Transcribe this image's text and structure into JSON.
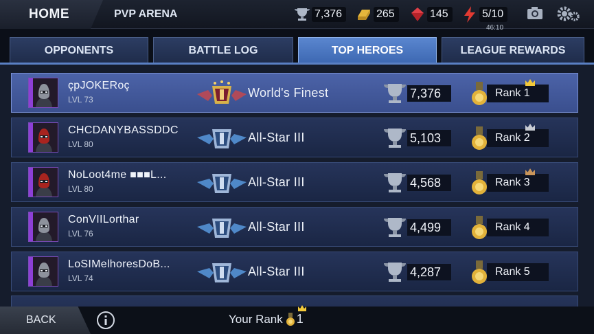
{
  "header": {
    "home_label": "HOME",
    "page_title": "PVP ARENA",
    "trophies": "7,376",
    "gold": "265",
    "crystals": "145",
    "energy": "5/10",
    "energy_timer": "46:10"
  },
  "tabs": [
    {
      "label": "OPPONENTS",
      "active": false
    },
    {
      "label": "BATTLE LOG",
      "active": false
    },
    {
      "label": "TOP HEROES",
      "active": true
    },
    {
      "label": "LEAGUE REWARDS",
      "active": false
    }
  ],
  "rows": [
    {
      "name": "çpJOKERoç",
      "level": "LVL 73",
      "league": "World's Finest",
      "score": "7,376",
      "rank": "Rank 1",
      "highlight": true,
      "crown_color": "#f3c93a"
    },
    {
      "name": "CHCDANYBASSDDC",
      "level": "LVL 80",
      "league": "All-Star III",
      "score": "5,103",
      "rank": "Rank 2",
      "highlight": false,
      "crown_color": "#c8ccd4"
    },
    {
      "name": "NoLoot4me ■■■L...",
      "level": "LVL 80",
      "league": "All-Star III",
      "score": "4,568",
      "rank": "Rank 3",
      "highlight": false,
      "crown_color": "#c9955a"
    },
    {
      "name": "ConVIILorthar",
      "level": "LVL 76",
      "league": "All-Star III",
      "score": "4,499",
      "rank": "Rank 4",
      "highlight": false,
      "crown_color": ""
    },
    {
      "name": "LoSIMelhoresDoB...",
      "level": "LVL 74",
      "league": "All-Star III",
      "score": "4,287",
      "rank": "Rank 5",
      "highlight": false,
      "crown_color": ""
    }
  ],
  "footer": {
    "back_label": "BACK",
    "your_rank_label": "Your Rank",
    "your_rank_value": "1"
  },
  "colors": {
    "accent_tab": "#4a76c0",
    "row_bg": "#1f2c4c",
    "row_highlight": "#4258a0",
    "gold": "#e3b33a"
  }
}
